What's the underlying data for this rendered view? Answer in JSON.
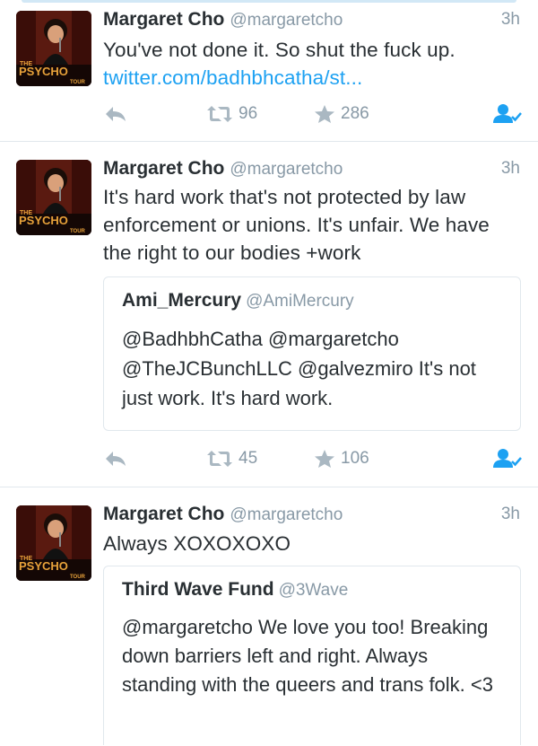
{
  "tweets": [
    {
      "name": "Margaret Cho",
      "handle": "@margaretcho",
      "time": "3h",
      "text": "You've not done it. So shut the fuck up.",
      "link": "twitter.com/badhbhcatha/st...",
      "retweets": "96",
      "favorites": "286"
    },
    {
      "name": "Margaret Cho",
      "handle": "@margaretcho",
      "time": "3h",
      "text": "It's hard work that's not protected by law enforcement or unions. It's unfair. We have the right to our bodies +work",
      "quote": {
        "name": "Ami_Mercury",
        "handle": "@AmiMercury",
        "text": "@BadhbhCatha @margaretcho @TheJCBunchLLC @galvezmiro It's not just work. It's hard work."
      },
      "retweets": "45",
      "favorites": "106"
    },
    {
      "name": "Margaret Cho",
      "handle": "@margaretcho",
      "time": "3h",
      "text": "Always XOXOXOXO",
      "quote": {
        "name": "Third Wave Fund",
        "handle": "@3Wave",
        "text": "@margaretcho We love you too! Breaking down barriers left and right. Always standing with the queers and trans folk. <3"
      }
    }
  ],
  "avatar": {
    "top_text": "THE",
    "main_text": "PSYCHO",
    "bottom_text": "TOUR"
  },
  "colors": {
    "accent": "#1da1f2",
    "muted": "#8899a6",
    "text": "#292f33",
    "divider": "#e1e8ed",
    "avatar_text": "#e8a23a"
  },
  "icons": [
    "reply-icon",
    "retweet-icon",
    "favorite-icon",
    "follow-icon"
  ]
}
